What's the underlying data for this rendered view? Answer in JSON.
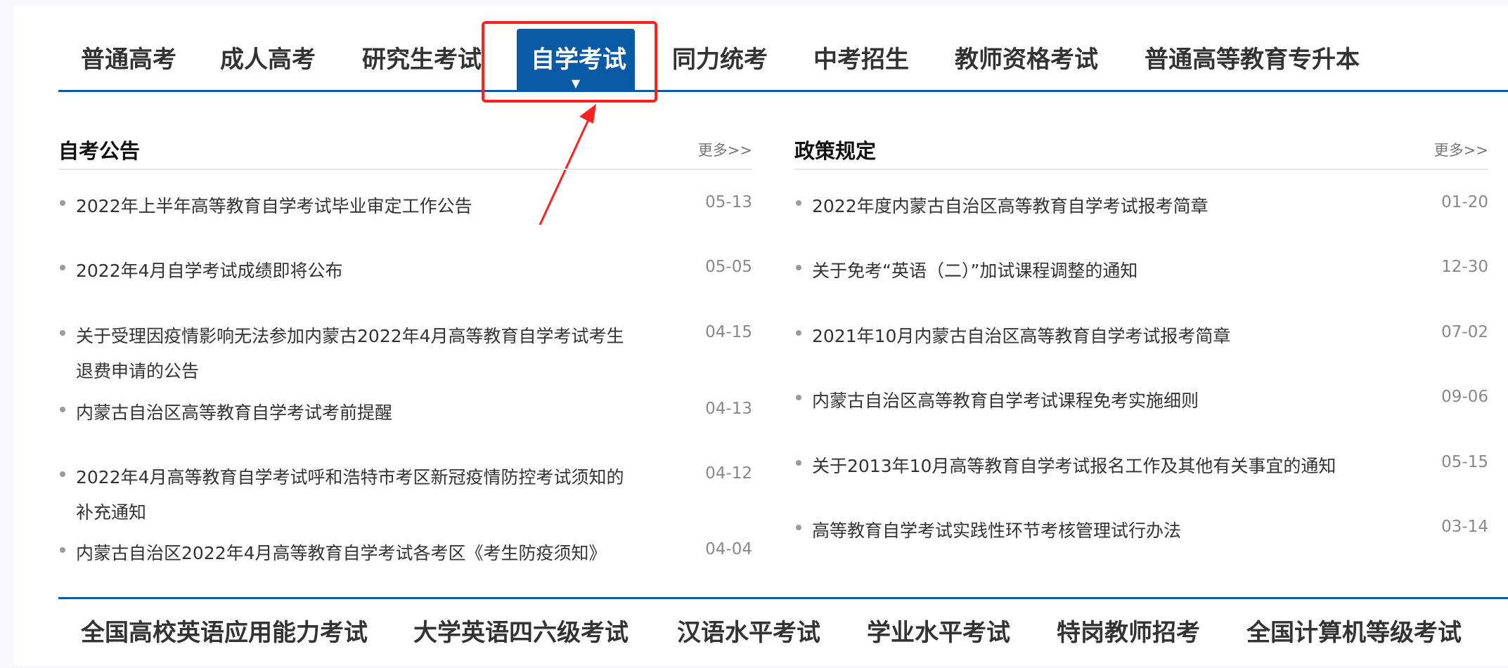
{
  "top_tabs": [
    {
      "label": "普通高考",
      "active": false
    },
    {
      "label": "成人高考",
      "active": false
    },
    {
      "label": "研究生考试",
      "active": false
    },
    {
      "label": "自学考试",
      "active": true
    },
    {
      "label": "同力统考",
      "active": false
    },
    {
      "label": "中考招生",
      "active": false
    },
    {
      "label": "教师资格考试",
      "active": false
    },
    {
      "label": "普通高等教育专升本",
      "active": false
    }
  ],
  "active_caret": "▼",
  "annotation_color": "#ff2020",
  "accent_color": "#0a5aa5",
  "left_panel": {
    "title": "自考公告",
    "more": "更多>>",
    "items": [
      {
        "title": "2022年上半年高等教育自学考试毕业审定工作公告",
        "date": "05-13"
      },
      {
        "title": "2022年4月自学考试成绩即将公布",
        "date": "05-05"
      },
      {
        "title": "关于受理因疫情影响无法参加内蒙古2022年4月高等教育自学考试考生退费申请的公告",
        "date": "04-15"
      },
      {
        "title": "内蒙古自治区高等教育自学考试考前提醒",
        "date": "04-13"
      },
      {
        "title": "2022年4月高等教育自学考试呼和浩特市考区新冠疫情防控考试须知的补充通知",
        "date": "04-12"
      },
      {
        "title": "内蒙古自治区2022年4月高等教育自学考试各考区《考生防疫须知》",
        "date": "04-04"
      }
    ]
  },
  "right_panel": {
    "title": "政策规定",
    "more": "更多>>",
    "items": [
      {
        "title": "2022年度内蒙古自治区高等教育自学考试报考简章",
        "date": "01-20"
      },
      {
        "title": "关于免考“英语（二）”加试课程调整的通知",
        "date": "12-30"
      },
      {
        "title": "2021年10月内蒙古自治区高等教育自学考试报考简章",
        "date": "07-02"
      },
      {
        "title": "内蒙古自治区高等教育自学考试课程免考实施细则",
        "date": "09-06"
      },
      {
        "title": "关于2013年10月高等教育自学考试报名工作及其他有关事宜的通知",
        "date": "05-15"
      },
      {
        "title": "高等教育自学考试实践性环节考核管理试行办法",
        "date": "03-14"
      }
    ]
  },
  "bottom_tabs": [
    {
      "label": "全国高校英语应用能力考试"
    },
    {
      "label": "大学英语四六级考试"
    },
    {
      "label": "汉语水平考试"
    },
    {
      "label": "学业水平考试"
    },
    {
      "label": "特岗教师招考"
    },
    {
      "label": "全国计算机等级考试"
    }
  ]
}
